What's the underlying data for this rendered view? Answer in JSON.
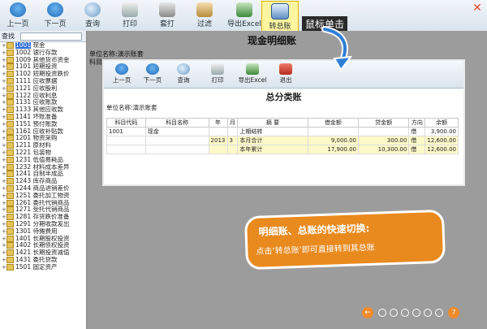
{
  "toolbar": {
    "prev": "上一页",
    "next": "下一页",
    "query": "查询",
    "print": "打印",
    "post": "套打",
    "filter": "过滤",
    "export": "导出Excel",
    "switch": "转总账"
  },
  "callout_top": "鼠标单击",
  "sidebar": {
    "search_label": "查找",
    "items": [
      {
        "code": "1001",
        "name": "现金",
        "selected": true
      },
      {
        "code": "1002",
        "name": "银行存款"
      },
      {
        "code": "1009",
        "name": "其他货币资金"
      },
      {
        "code": "1101",
        "name": "短期投资"
      },
      {
        "code": "1102",
        "name": "短期投资跌价"
      },
      {
        "code": "1111",
        "name": "应收票据"
      },
      {
        "code": "1121",
        "name": "应收股利"
      },
      {
        "code": "1122",
        "name": "应收利息"
      },
      {
        "code": "1131",
        "name": "应收账款"
      },
      {
        "code": "1133",
        "name": "其他应收款"
      },
      {
        "code": "1141",
        "name": "坏账准备"
      },
      {
        "code": "1151",
        "name": "预付账款"
      },
      {
        "code": "1161",
        "name": "应收补贴款"
      },
      {
        "code": "1201",
        "name": "物资采购"
      },
      {
        "code": "1211",
        "name": "原材料"
      },
      {
        "code": "1221",
        "name": "包装物"
      },
      {
        "code": "1231",
        "name": "低值易耗品"
      },
      {
        "code": "1232",
        "name": "材料成本差异"
      },
      {
        "code": "1241",
        "name": "自制半成品"
      },
      {
        "code": "1243",
        "name": "库存商品"
      },
      {
        "code": "1244",
        "name": "商品进销差价"
      },
      {
        "code": "1251",
        "name": "委托加工物资"
      },
      {
        "code": "1261",
        "name": "委托代销商品"
      },
      {
        "code": "1271",
        "name": "受托代销商品"
      },
      {
        "code": "1281",
        "name": "存货跌价准备"
      },
      {
        "code": "1291",
        "name": "分期收款发出"
      },
      {
        "code": "1301",
        "name": "待摊费用"
      },
      {
        "code": "1401",
        "name": "长期股权投资"
      },
      {
        "code": "1402",
        "name": "长期债权投资"
      },
      {
        "code": "1421",
        "name": "长期投资减值"
      },
      {
        "code": "1431",
        "name": "委托贷款"
      },
      {
        "code": "1501",
        "name": "固定资产"
      }
    ]
  },
  "main": {
    "title": "现金明细账",
    "unit": "单位名称:演示账套",
    "col_hint": "科目"
  },
  "overlay": {
    "toolbar": {
      "prev": "上一页",
      "next": "下一页",
      "query": "查询",
      "print": "打印",
      "export": "导出Excel",
      "exit": "退出"
    },
    "title": "总分类账",
    "unit": "单位名称:演示账套",
    "headers": [
      "科目代码",
      "科目名称",
      "年",
      "月",
      "摘  要",
      "借金额",
      "贷金额",
      "方向",
      "余额"
    ],
    "rows": [
      {
        "code": "1001",
        "name": "现金",
        "year": "",
        "month": "",
        "summary": "上期结转",
        "debit": "",
        "credit": "",
        "dir": "借",
        "balance": "3,900.00"
      },
      {
        "code": "",
        "name": "",
        "year": "2013",
        "month": "3",
        "summary": "本月合计",
        "debit": "9,000.00",
        "credit": "300.00",
        "dir": "借",
        "balance": "12,600.00"
      },
      {
        "code": "",
        "name": "",
        "year": "",
        "month": "",
        "summary": "本年累计",
        "debit": "17,900.00",
        "credit": "10,300.00",
        "dir": "借",
        "balance": "12,600.00"
      }
    ]
  },
  "promo": {
    "headline": "明细账、总账的快速切换:",
    "body": "点击‘转总账’即可直接转到其总账"
  },
  "pager": {
    "current": "7"
  }
}
